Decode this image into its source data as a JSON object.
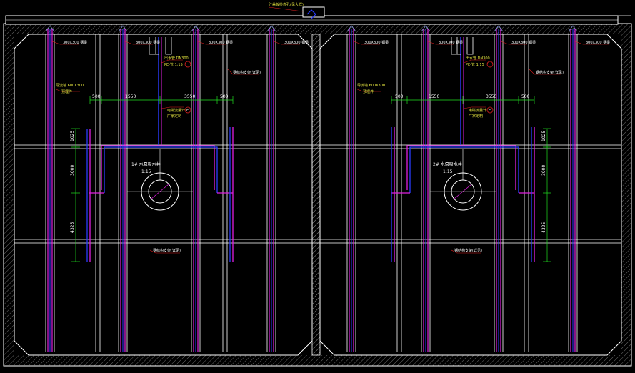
{
  "drawing": {
    "background": "#000000",
    "colors": {
      "wall": "#ffffff",
      "pipe_magenta": "#e020e0",
      "pipe_blue": "#2a3cff",
      "dimension": "#20e020",
      "leader": "#e02020",
      "text": "#ffffff",
      "text_yellow": "#e8e840"
    },
    "top_label": "砼盖板检修孔(见大样)",
    "chambers": [
      {
        "id": "left",
        "well_label": "1# 水泵吸水井",
        "well_sublabel": "1:15",
        "dim_top": [
          "500",
          "1550",
          "3550",
          "500"
        ],
        "dim_side": [
          "1025",
          "3000",
          "4325"
        ],
        "labels": {
          "top_1": "300X300 钢梁",
          "top_2": "300X300 钢梁",
          "top_3": "300X300 钢梁",
          "top_4": "300X300 钢梁",
          "pipe_note": "出水管 DN300",
          "pipe_note_2": "PE-管 1:15",
          "beam_note": "钢结构支架(详见)",
          "left_note": "导流墙 600X300",
          "left_note_2": "预埋件",
          "valve_note": "电磁流量计",
          "valve_note_2": "厂家定制",
          "bottom_note": "钢结构支架(详见)"
        }
      },
      {
        "id": "right",
        "well_label": "2# 水泵吸水井",
        "well_sublabel": "1:15",
        "dim_top": [
          "500",
          "1550",
          "3550",
          "500"
        ],
        "dim_side": [
          "1025",
          "3000",
          "4325"
        ],
        "labels": {
          "top_1": "300X300 钢梁",
          "top_2": "300X300 钢梁",
          "top_3": "300X300 钢梁",
          "top_4": "300X300 钢梁",
          "pipe_note": "出水管 DN300",
          "pipe_note_2": "PE-管 1:15",
          "beam_note": "钢结构支架(详见)",
          "left_note": "导流墙 600X300",
          "left_note_2": "预埋件",
          "valve_note": "电磁流量计",
          "valve_note_2": "厂家定制",
          "bottom_note": "钢结构支架(详见)"
        }
      }
    ],
    "circle_marker": "E"
  }
}
